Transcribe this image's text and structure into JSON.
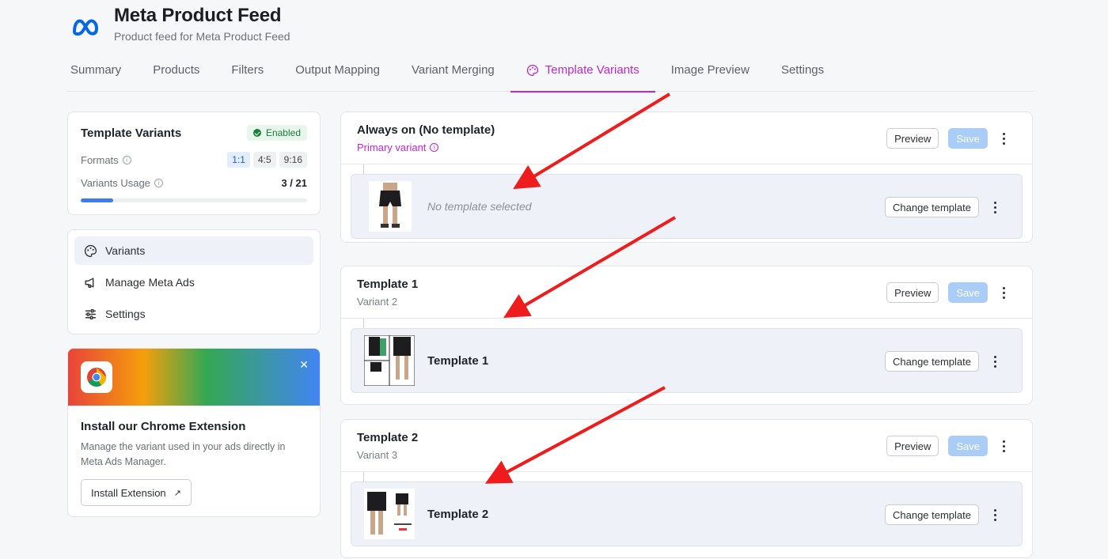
{
  "header": {
    "title": "Meta Product Feed",
    "subtitle": "Product feed for Meta Product Feed"
  },
  "tabs": [
    {
      "label": "Summary"
    },
    {
      "label": "Products"
    },
    {
      "label": "Filters"
    },
    {
      "label": "Output Mapping"
    },
    {
      "label": "Variant Merging"
    },
    {
      "label": "Template Variants",
      "active": true
    },
    {
      "label": "Image Preview"
    },
    {
      "label": "Settings"
    }
  ],
  "template_variants_card": {
    "title": "Template Variants",
    "status": "Enabled",
    "formats_label": "Formats",
    "formats": [
      "1:1",
      "4:5",
      "9:16"
    ],
    "active_format": "1:1",
    "usage_label": "Variants Usage",
    "usage_value": "3 / 21",
    "usage_fraction": 0.143
  },
  "nav": [
    {
      "label": "Variants",
      "icon": "palette-icon",
      "active": true
    },
    {
      "label": "Manage Meta Ads",
      "icon": "megaphone-icon"
    },
    {
      "label": "Settings",
      "icon": "sliders-icon"
    }
  ],
  "extension": {
    "title": "Install our Chrome Extension",
    "description": "Manage the variant used in your ads directly in Meta Ads Manager.",
    "button": "Install Extension",
    "icon": "chrome-icon"
  },
  "variants": [
    {
      "title": "Always on (No template)",
      "subtitle": "Primary variant",
      "primary": true,
      "template_label": "No template selected",
      "empty": true
    },
    {
      "title": "Template 1",
      "subtitle": "Variant 2",
      "template_label": "Template 1"
    },
    {
      "title": "Template 2",
      "subtitle": "Variant 3",
      "template_label": "Template 2"
    }
  ],
  "actions": {
    "preview": "Preview",
    "save": "Save",
    "change_template": "Change template"
  },
  "colors": {
    "accent": "#c026d3",
    "save_disabled": "#a9cdf7",
    "enabled_green": "#1a7f37",
    "arrow_red": "#ee1c1c"
  }
}
